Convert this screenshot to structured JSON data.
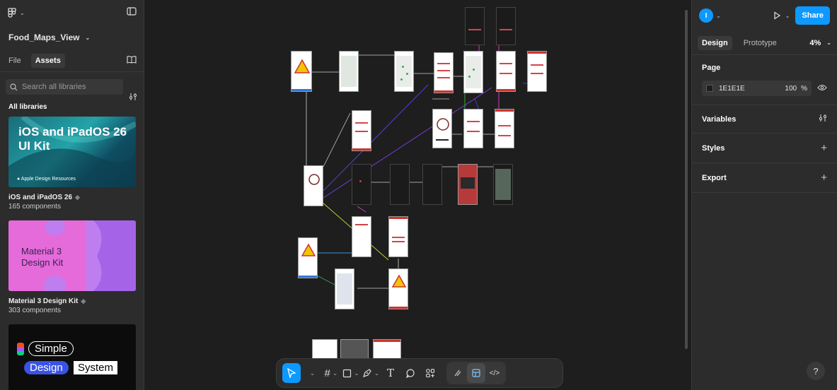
{
  "left_panel": {
    "file_name": "Food_Maps_View",
    "tabs": [
      "File",
      "Assets"
    ],
    "search_placeholder": "Search all libraries",
    "section_title": "All libraries",
    "libraries": [
      {
        "thumb_text": "iOS and iPadOS 26 UI Kit",
        "thumb_sub": "Apple Design Resources",
        "name": "iOS and iPadOS 26",
        "count": "165 components"
      },
      {
        "thumb_text": "Material 3 Design Kit",
        "name": "Material 3 Design Kit",
        "count": "303 components"
      },
      {
        "thumb_text": "Simple",
        "thumb_text2": "Design",
        "thumb_text3": "System"
      }
    ]
  },
  "right_panel": {
    "avatar": "I",
    "share_label": "Share",
    "tabs": [
      "Design",
      "Prototype"
    ],
    "zoom": "4%",
    "page_label": "Page",
    "page_color": "1E1E1E",
    "page_opacity": "100",
    "opacity_unit": "%",
    "sections": [
      "Variables",
      "Styles",
      "Export"
    ],
    "help": "?"
  },
  "toolbar": {
    "text_tool": "T"
  },
  "colors": {
    "accent": "#0d99ff",
    "panel": "#2c2c2c",
    "canvas": "#1e1e1e",
    "app_red": "#c9362f"
  }
}
